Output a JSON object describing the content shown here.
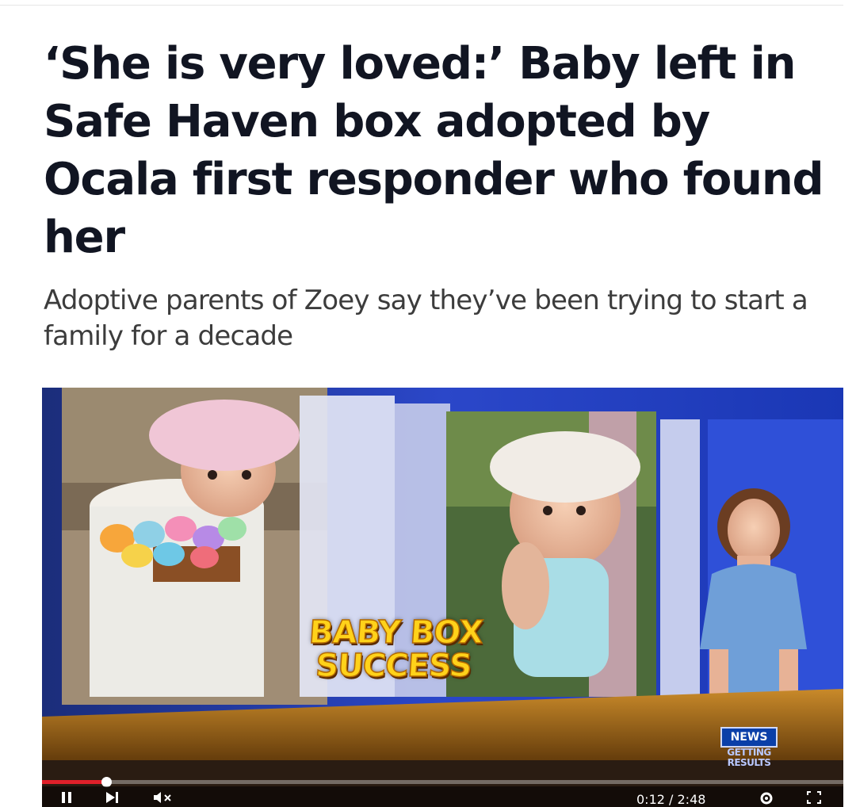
{
  "article": {
    "headline": "‘She is very loved:’ Baby left in Safe Haven box adopted by Ocala first responder who found her",
    "subheadline": "Adoptive parents of Zoey say they’ve been trying to start a family for a decade"
  },
  "video": {
    "lower_third": [
      "BABY BOX",
      "SUCCESS"
    ],
    "station_logo": {
      "top": "NEWS",
      "tagline_1": "GETTING",
      "tagline_2": "RESULTS"
    },
    "progress": 0.08,
    "current_time": "0:12",
    "duration": "2:48",
    "time_separator": " / ",
    "controls": {
      "play_icon": "pause-icon",
      "next_icon": "skip-next-icon",
      "volume_icon": "volume-muted-icon",
      "settings_icon": "gear-icon",
      "fullscreen_icon": "fullscreen-icon"
    }
  },
  "colors": {
    "headline": "#111522",
    "subheadline": "#3c3c3c",
    "progress": "#e0202a",
    "studio_blue": "#1633a8",
    "lower_third": "#ffd21a"
  }
}
